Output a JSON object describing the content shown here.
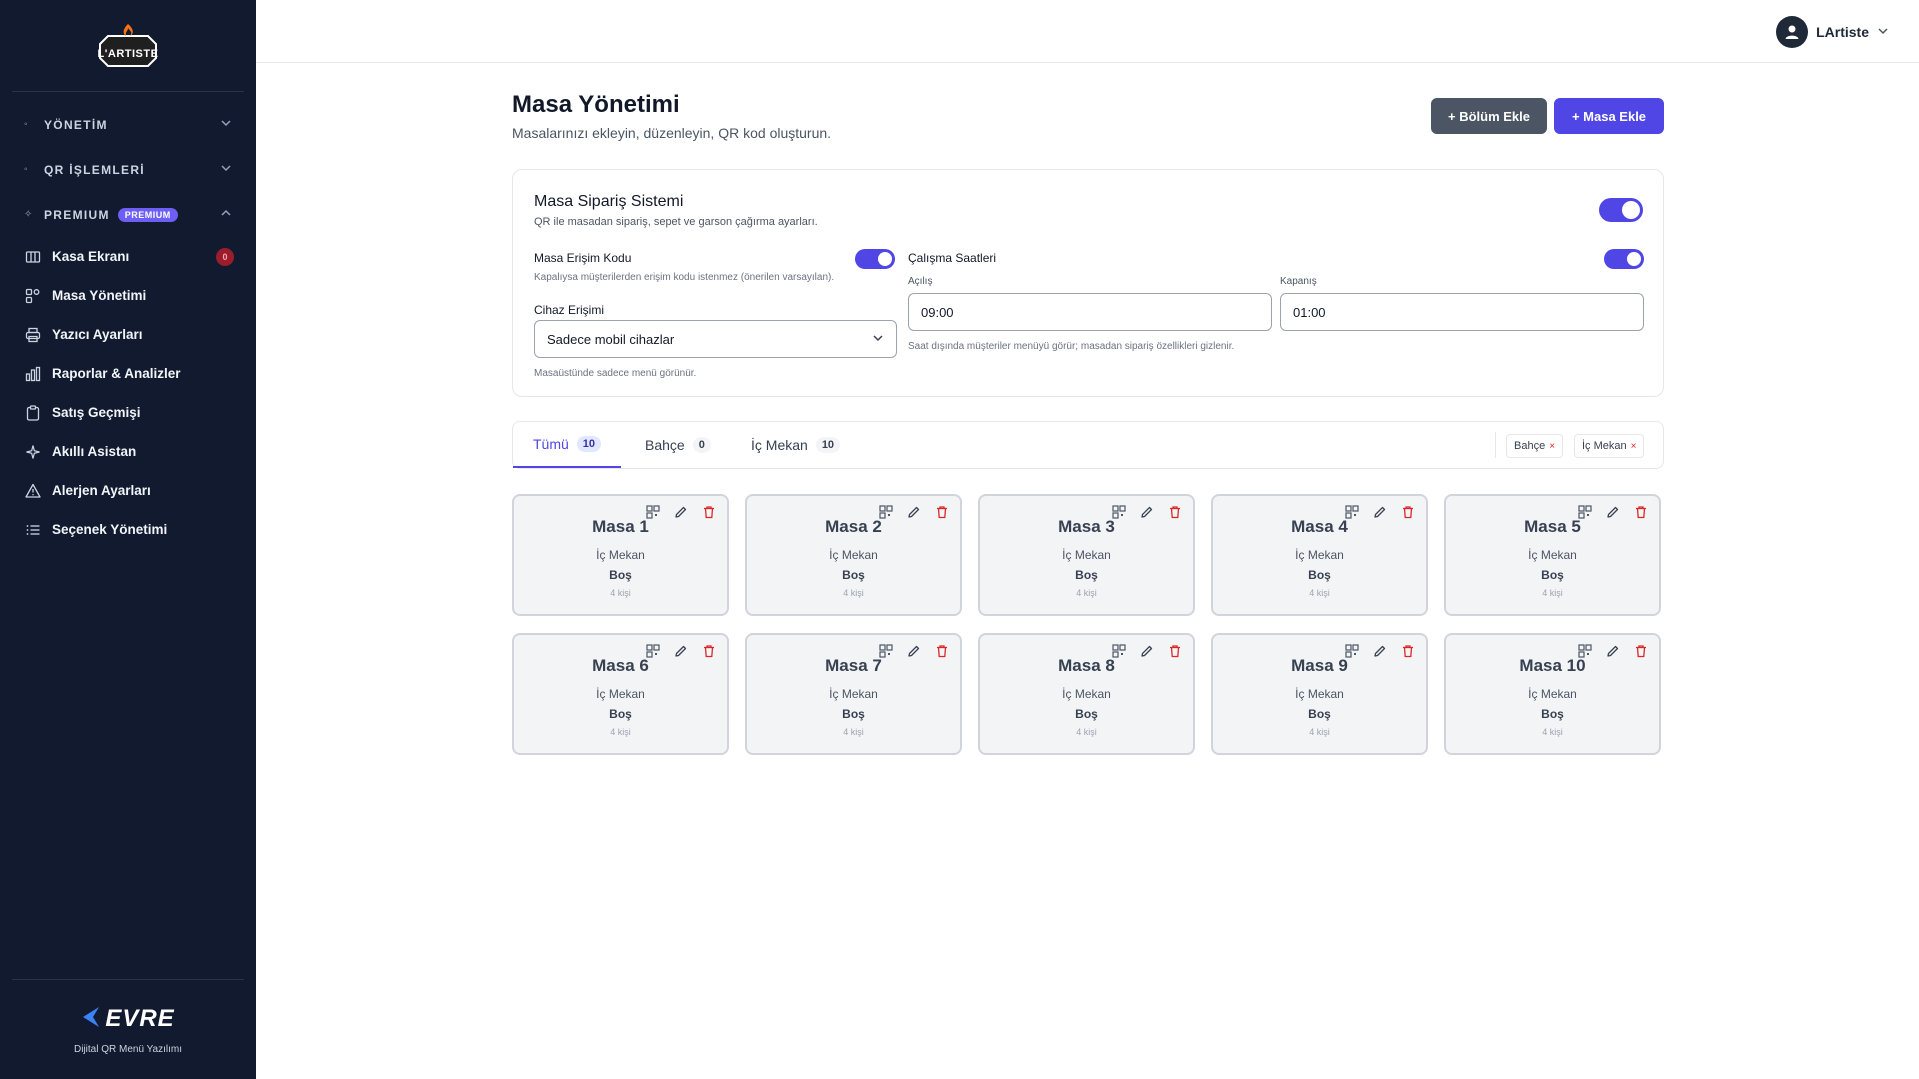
{
  "sidebar": {
    "logo_text": "L'ARTISTE",
    "sections": [
      {
        "label": "YÖNETİM"
      },
      {
        "label": "QR İŞLEMLERİ"
      },
      {
        "label": "PREMIUM",
        "badge": "PREMIUM"
      }
    ],
    "items": [
      {
        "label": "Kasa Ekranı",
        "icon": "cash-register-icon",
        "count": "0"
      },
      {
        "label": "Masa Yönetimi",
        "icon": "table-grid-icon"
      },
      {
        "label": "Yazıcı Ayarları",
        "icon": "printer-icon"
      },
      {
        "label": "Raporlar & Analizler",
        "icon": "chart-icon"
      },
      {
        "label": "Satış Geçmişi",
        "icon": "clipboard-icon"
      },
      {
        "label": "Akıllı Asistan",
        "icon": "sparkle-icon"
      },
      {
        "label": "Alerjen Ayarları",
        "icon": "warning-icon"
      },
      {
        "label": "Seçenek Yönetimi",
        "icon": "list-icon"
      }
    ],
    "footer": {
      "brand": "EVRE",
      "tagline": "Dijital QR Menü Yazılımı"
    }
  },
  "topbar": {
    "user_name": "LArtiste"
  },
  "page": {
    "title": "Masa Yönetimi",
    "subtitle": "Masalarınızı ekleyin, düzenleyin, QR kod oluşturun.",
    "add_section_label": "+ Bölüm Ekle",
    "add_table_label": "+ Masa Ekle"
  },
  "order_system": {
    "title": "Masa Sipariş Sistemi",
    "subtitle": "QR ile masadan sipariş, sepet ve garson çağırma ayarları.",
    "enabled": true,
    "access_code": {
      "label": "Masa Erişim Kodu",
      "hint": "Kapalıysa müşterilerden erişim kodu istenmez (önerilen varsayılan).",
      "enabled": true
    },
    "device_access": {
      "label": "Cihaz Erişimi",
      "value": "Sadece mobil cihazlar",
      "hint": "Masaüstünde sadece menü görünür."
    },
    "working_hours": {
      "label": "Çalışma Saatleri",
      "enabled": true,
      "open_label": "Açılış",
      "open_value": "09:00",
      "close_label": "Kapanış",
      "close_value": "01:00",
      "hint": "Saat dışında müşteriler menüyü görür; masadan sipariş özellikleri gizlenir."
    }
  },
  "tabs": [
    {
      "label": "Tümü",
      "count": "10",
      "active": true
    },
    {
      "label": "Bahçe",
      "count": "0"
    },
    {
      "label": "İç Mekan",
      "count": "10"
    }
  ],
  "filter_chips": [
    {
      "label": "Bahçe",
      "remove": "×"
    },
    {
      "label": "İç Mekan",
      "remove": "×"
    }
  ],
  "tables": [
    {
      "name": "Masa 1",
      "section": "İç Mekan",
      "status": "Boş",
      "capacity": "4 kişi"
    },
    {
      "name": "Masa 2",
      "section": "İç Mekan",
      "status": "Boş",
      "capacity": "4 kişi"
    },
    {
      "name": "Masa 3",
      "section": "İç Mekan",
      "status": "Boş",
      "capacity": "4 kişi"
    },
    {
      "name": "Masa 4",
      "section": "İç Mekan",
      "status": "Boş",
      "capacity": "4 kişi"
    },
    {
      "name": "Masa 5",
      "section": "İç Mekan",
      "status": "Boş",
      "capacity": "4 kişi"
    },
    {
      "name": "Masa 6",
      "section": "İç Mekan",
      "status": "Boş",
      "capacity": "4 kişi"
    },
    {
      "name": "Masa 7",
      "section": "İç Mekan",
      "status": "Boş",
      "capacity": "4 kişi"
    },
    {
      "name": "Masa 8",
      "section": "İç Mekan",
      "status": "Boş",
      "capacity": "4 kişi"
    },
    {
      "name": "Masa 9",
      "section": "İç Mekan",
      "status": "Boş",
      "capacity": "4 kişi"
    },
    {
      "name": "Masa 10",
      "section": "İç Mekan",
      "status": "Boş",
      "capacity": "4 kişi"
    }
  ],
  "colors": {
    "sidebar_bg": "#111a2e",
    "accent": "#4f46e5",
    "danger": "#dc2626"
  }
}
